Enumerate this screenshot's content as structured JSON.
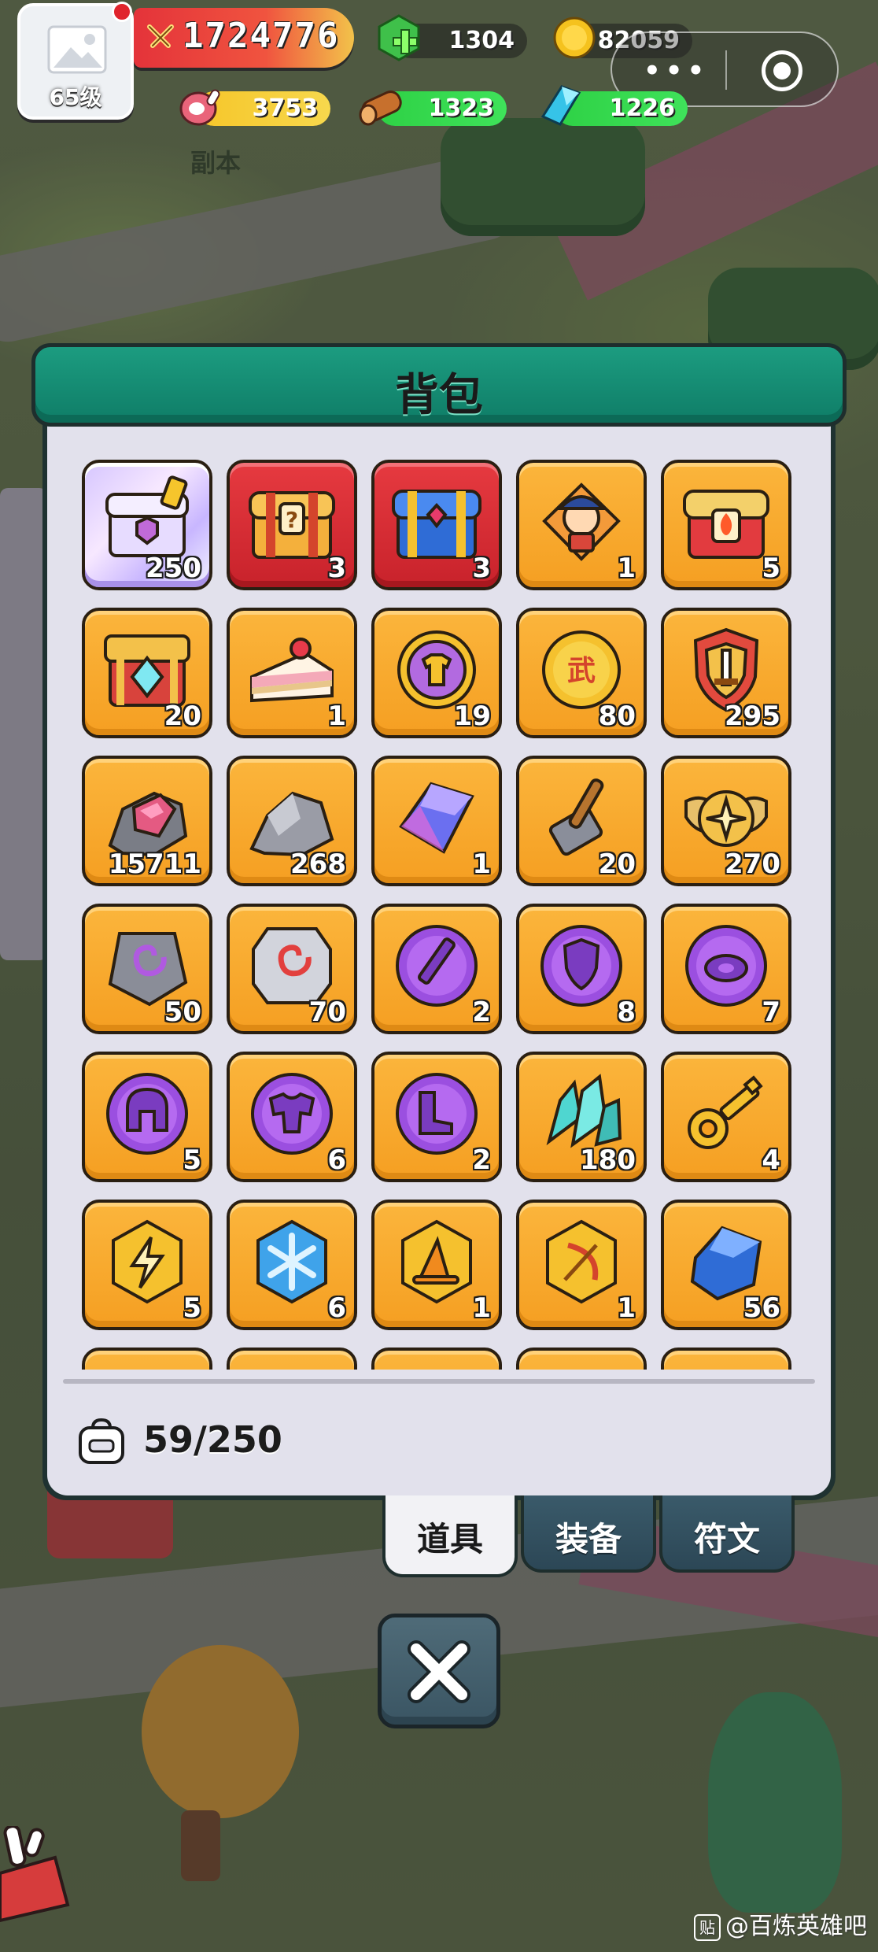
{
  "hud": {
    "level": "65级",
    "power": "1724776",
    "gem": "1304",
    "gold": "82059",
    "meat": "3753",
    "wood": "1323",
    "crystal": "1226",
    "dungeon_label": "副本"
  },
  "panel": {
    "title": "背包",
    "capacity": "59/250"
  },
  "tabs": [
    {
      "label": "道具",
      "active": true
    },
    {
      "label": "装备",
      "active": false
    },
    {
      "label": "符文",
      "active": false
    }
  ],
  "items": [
    {
      "icon": "legendary-chest-icon",
      "count": "250"
    },
    {
      "icon": "mystery-chest-icon",
      "count": "3"
    },
    {
      "icon": "blue-gold-chest-icon",
      "count": "3"
    },
    {
      "icon": "hero-portrait-icon",
      "count": "1"
    },
    {
      "icon": "fire-chest-icon",
      "count": "5"
    },
    {
      "icon": "diamond-chest-icon",
      "count": "20"
    },
    {
      "icon": "cake-icon",
      "count": "1"
    },
    {
      "icon": "shirt-coin-icon",
      "count": "19"
    },
    {
      "icon": "wu-coin-icon",
      "count": "80"
    },
    {
      "icon": "sword-badge-icon",
      "count": "295"
    },
    {
      "icon": "pink-ore-icon",
      "count": "15711"
    },
    {
      "icon": "stone-icon",
      "count": "268"
    },
    {
      "icon": "blue-crystal-icon",
      "count": "1"
    },
    {
      "icon": "hammer-icon",
      "count": "20"
    },
    {
      "icon": "winged-emblem-icon",
      "count": "270"
    },
    {
      "icon": "swirl-rune-stone-icon",
      "count": "50"
    },
    {
      "icon": "red-rune-stone-icon",
      "count": "70"
    },
    {
      "icon": "sword-orb-icon",
      "count": "2"
    },
    {
      "icon": "shield-orb-icon",
      "count": "8"
    },
    {
      "icon": "ring-orb-icon",
      "count": "7"
    },
    {
      "icon": "helmet-orb-icon",
      "count": "5"
    },
    {
      "icon": "armor-orb-icon",
      "count": "6"
    },
    {
      "icon": "boots-orb-icon",
      "count": "2"
    },
    {
      "icon": "cyan-crystal-icon",
      "count": "180"
    },
    {
      "icon": "key-icon",
      "count": "4"
    },
    {
      "icon": "lightning-token-icon",
      "count": "5"
    },
    {
      "icon": "snowflake-token-icon",
      "count": "6"
    },
    {
      "icon": "hat-token-icon",
      "count": "1"
    },
    {
      "icon": "bow-token-icon",
      "count": "1"
    },
    {
      "icon": "blue-gem-icon",
      "count": "56"
    }
  ],
  "watermark": "@百炼英雄吧",
  "watermark_badge": "贴"
}
